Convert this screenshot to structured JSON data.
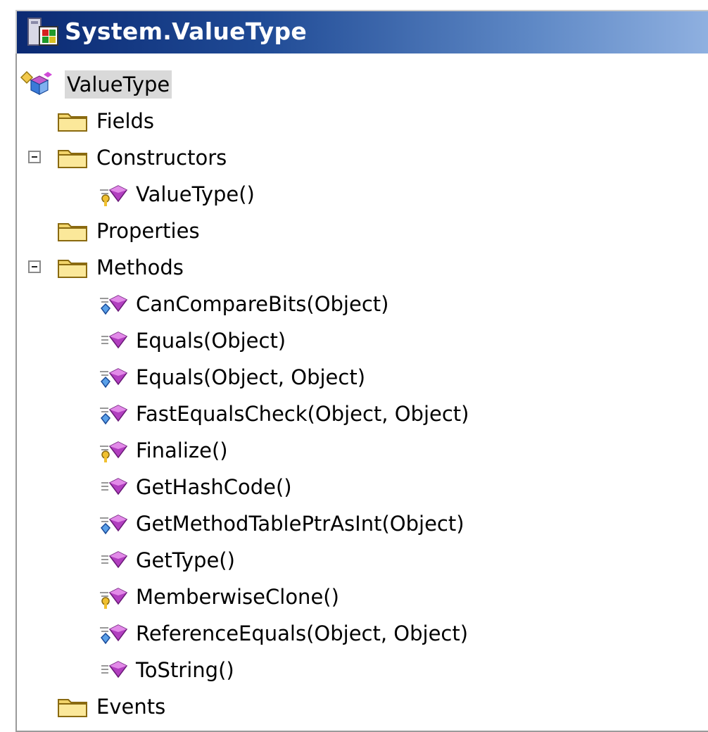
{
  "window": {
    "title": "System.ValueType",
    "title_icon": "class-icon"
  },
  "colors": {
    "titlebar_start": "#0b2a73",
    "titlebar_end": "#8fb0e0",
    "selection": "#d9d9d9",
    "folder": "#f2d46a",
    "method": "#b23fc0"
  },
  "tree": {
    "root": {
      "label": "ValueType",
      "icon": "class-type-icon",
      "selected": true
    },
    "fields": {
      "label": "Fields",
      "icon": "folder-icon"
    },
    "constructors": {
      "label": "Constructors",
      "icon": "folder-icon",
      "expanded": true,
      "items": [
        {
          "label": "ValueType()",
          "icon": "protected-method-icon"
        }
      ]
    },
    "properties": {
      "label": "Properties",
      "icon": "folder-icon"
    },
    "methods": {
      "label": "Methods",
      "icon": "folder-icon",
      "expanded": true,
      "items": [
        {
          "label": "CanCompareBits(Object)",
          "icon": "static-method-icon"
        },
        {
          "label": "Equals(Object)",
          "icon": "public-method-icon"
        },
        {
          "label": "Equals(Object, Object)",
          "icon": "static-method-icon"
        },
        {
          "label": "FastEqualsCheck(Object, Object)",
          "icon": "static-method-icon"
        },
        {
          "label": "Finalize()",
          "icon": "protected-method-icon"
        },
        {
          "label": "GetHashCode()",
          "icon": "public-method-icon"
        },
        {
          "label": "GetMethodTablePtrAsInt(Object)",
          "icon": "static-method-icon"
        },
        {
          "label": "GetType()",
          "icon": "public-method-icon"
        },
        {
          "label": "MemberwiseClone()",
          "icon": "protected-method-icon"
        },
        {
          "label": "ReferenceEquals(Object, Object)",
          "icon": "static-method-icon"
        },
        {
          "label": "ToString()",
          "icon": "public-method-icon"
        }
      ]
    },
    "events": {
      "label": "Events",
      "icon": "folder-icon"
    }
  }
}
